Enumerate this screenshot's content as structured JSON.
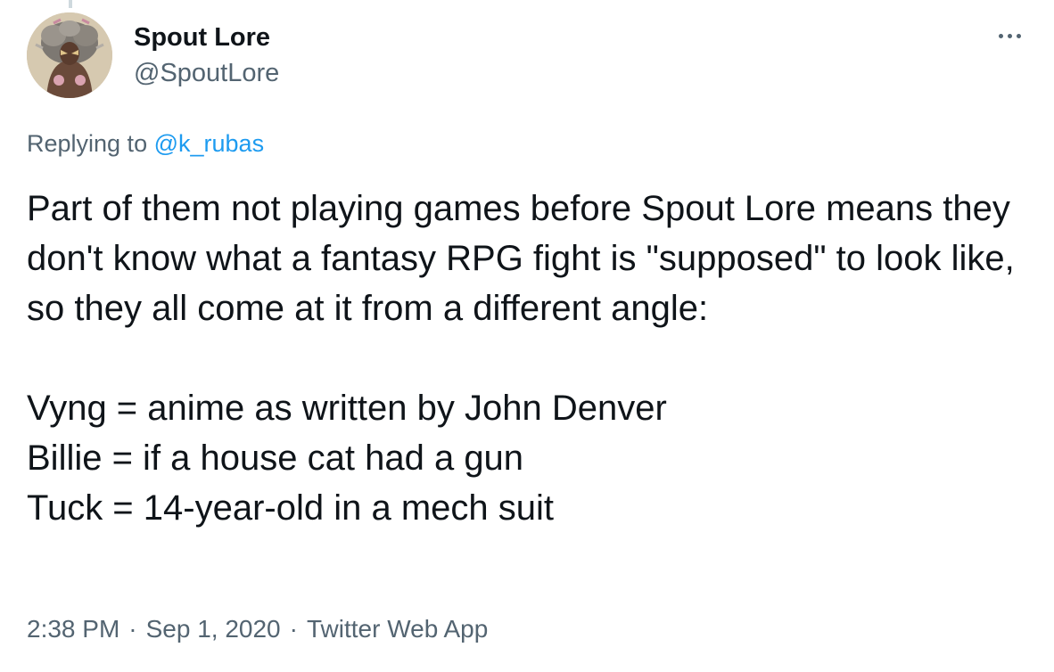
{
  "author": {
    "display_name": "Spout Lore",
    "handle": "@SpoutLore"
  },
  "reply": {
    "prefix": "Replying to",
    "mention": "@k_rubas"
  },
  "tweet": {
    "paragraph1": "Part of them not playing games before Spout Lore means they don't know what a fantasy RPG fight is \"supposed\" to look like, so they all come at it from a different angle:",
    "lines": [
      "Vyng = anime as written by John Denver",
      "Billie = if a house cat had a gun",
      "Tuck = 14-year-old in a mech suit"
    ]
  },
  "meta": {
    "time": "2:38 PM",
    "date": "Sep 1, 2020",
    "source": "Twitter Web App",
    "separator": "·"
  },
  "icons": {
    "more": "more-horizontal-icon"
  },
  "colors": {
    "text": "#0f1419",
    "secondary": "#536471",
    "link": "#1d9bf0",
    "thread_line": "#cfd9de"
  }
}
